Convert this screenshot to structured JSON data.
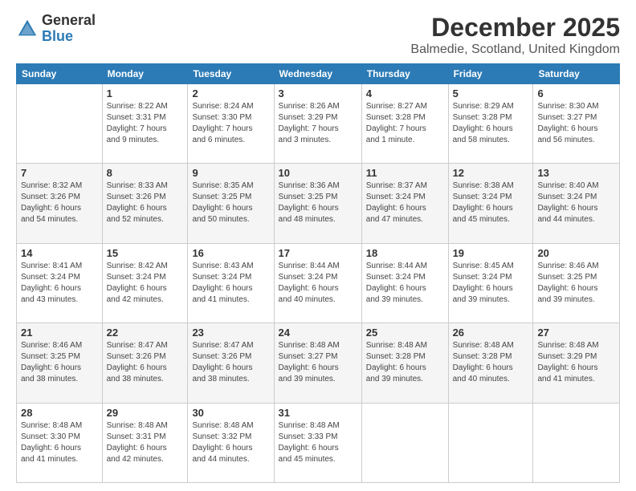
{
  "logo": {
    "general": "General",
    "blue": "Blue"
  },
  "title": "December 2025",
  "subtitle": "Balmedie, Scotland, United Kingdom",
  "days_header": [
    "Sunday",
    "Monday",
    "Tuesday",
    "Wednesday",
    "Thursday",
    "Friday",
    "Saturday"
  ],
  "weeks": [
    [
      {
        "num": "",
        "info": ""
      },
      {
        "num": "1",
        "info": "Sunrise: 8:22 AM\nSunset: 3:31 PM\nDaylight: 7 hours\nand 9 minutes."
      },
      {
        "num": "2",
        "info": "Sunrise: 8:24 AM\nSunset: 3:30 PM\nDaylight: 7 hours\nand 6 minutes."
      },
      {
        "num": "3",
        "info": "Sunrise: 8:26 AM\nSunset: 3:29 PM\nDaylight: 7 hours\nand 3 minutes."
      },
      {
        "num": "4",
        "info": "Sunrise: 8:27 AM\nSunset: 3:28 PM\nDaylight: 7 hours\nand 1 minute."
      },
      {
        "num": "5",
        "info": "Sunrise: 8:29 AM\nSunset: 3:28 PM\nDaylight: 6 hours\nand 58 minutes."
      },
      {
        "num": "6",
        "info": "Sunrise: 8:30 AM\nSunset: 3:27 PM\nDaylight: 6 hours\nand 56 minutes."
      }
    ],
    [
      {
        "num": "7",
        "info": "Sunrise: 8:32 AM\nSunset: 3:26 PM\nDaylight: 6 hours\nand 54 minutes."
      },
      {
        "num": "8",
        "info": "Sunrise: 8:33 AM\nSunset: 3:26 PM\nDaylight: 6 hours\nand 52 minutes."
      },
      {
        "num": "9",
        "info": "Sunrise: 8:35 AM\nSunset: 3:25 PM\nDaylight: 6 hours\nand 50 minutes."
      },
      {
        "num": "10",
        "info": "Sunrise: 8:36 AM\nSunset: 3:25 PM\nDaylight: 6 hours\nand 48 minutes."
      },
      {
        "num": "11",
        "info": "Sunrise: 8:37 AM\nSunset: 3:24 PM\nDaylight: 6 hours\nand 47 minutes."
      },
      {
        "num": "12",
        "info": "Sunrise: 8:38 AM\nSunset: 3:24 PM\nDaylight: 6 hours\nand 45 minutes."
      },
      {
        "num": "13",
        "info": "Sunrise: 8:40 AM\nSunset: 3:24 PM\nDaylight: 6 hours\nand 44 minutes."
      }
    ],
    [
      {
        "num": "14",
        "info": "Sunrise: 8:41 AM\nSunset: 3:24 PM\nDaylight: 6 hours\nand 43 minutes."
      },
      {
        "num": "15",
        "info": "Sunrise: 8:42 AM\nSunset: 3:24 PM\nDaylight: 6 hours\nand 42 minutes."
      },
      {
        "num": "16",
        "info": "Sunrise: 8:43 AM\nSunset: 3:24 PM\nDaylight: 6 hours\nand 41 minutes."
      },
      {
        "num": "17",
        "info": "Sunrise: 8:44 AM\nSunset: 3:24 PM\nDaylight: 6 hours\nand 40 minutes."
      },
      {
        "num": "18",
        "info": "Sunrise: 8:44 AM\nSunset: 3:24 PM\nDaylight: 6 hours\nand 39 minutes."
      },
      {
        "num": "19",
        "info": "Sunrise: 8:45 AM\nSunset: 3:24 PM\nDaylight: 6 hours\nand 39 minutes."
      },
      {
        "num": "20",
        "info": "Sunrise: 8:46 AM\nSunset: 3:25 PM\nDaylight: 6 hours\nand 39 minutes."
      }
    ],
    [
      {
        "num": "21",
        "info": "Sunrise: 8:46 AM\nSunset: 3:25 PM\nDaylight: 6 hours\nand 38 minutes."
      },
      {
        "num": "22",
        "info": "Sunrise: 8:47 AM\nSunset: 3:26 PM\nDaylight: 6 hours\nand 38 minutes."
      },
      {
        "num": "23",
        "info": "Sunrise: 8:47 AM\nSunset: 3:26 PM\nDaylight: 6 hours\nand 38 minutes."
      },
      {
        "num": "24",
        "info": "Sunrise: 8:48 AM\nSunset: 3:27 PM\nDaylight: 6 hours\nand 39 minutes."
      },
      {
        "num": "25",
        "info": "Sunrise: 8:48 AM\nSunset: 3:28 PM\nDaylight: 6 hours\nand 39 minutes."
      },
      {
        "num": "26",
        "info": "Sunrise: 8:48 AM\nSunset: 3:28 PM\nDaylight: 6 hours\nand 40 minutes."
      },
      {
        "num": "27",
        "info": "Sunrise: 8:48 AM\nSunset: 3:29 PM\nDaylight: 6 hours\nand 41 minutes."
      }
    ],
    [
      {
        "num": "28",
        "info": "Sunrise: 8:48 AM\nSunset: 3:30 PM\nDaylight: 6 hours\nand 41 minutes."
      },
      {
        "num": "29",
        "info": "Sunrise: 8:48 AM\nSunset: 3:31 PM\nDaylight: 6 hours\nand 42 minutes."
      },
      {
        "num": "30",
        "info": "Sunrise: 8:48 AM\nSunset: 3:32 PM\nDaylight: 6 hours\nand 44 minutes."
      },
      {
        "num": "31",
        "info": "Sunrise: 8:48 AM\nSunset: 3:33 PM\nDaylight: 6 hours\nand 45 minutes."
      },
      {
        "num": "",
        "info": ""
      },
      {
        "num": "",
        "info": ""
      },
      {
        "num": "",
        "info": ""
      }
    ]
  ]
}
